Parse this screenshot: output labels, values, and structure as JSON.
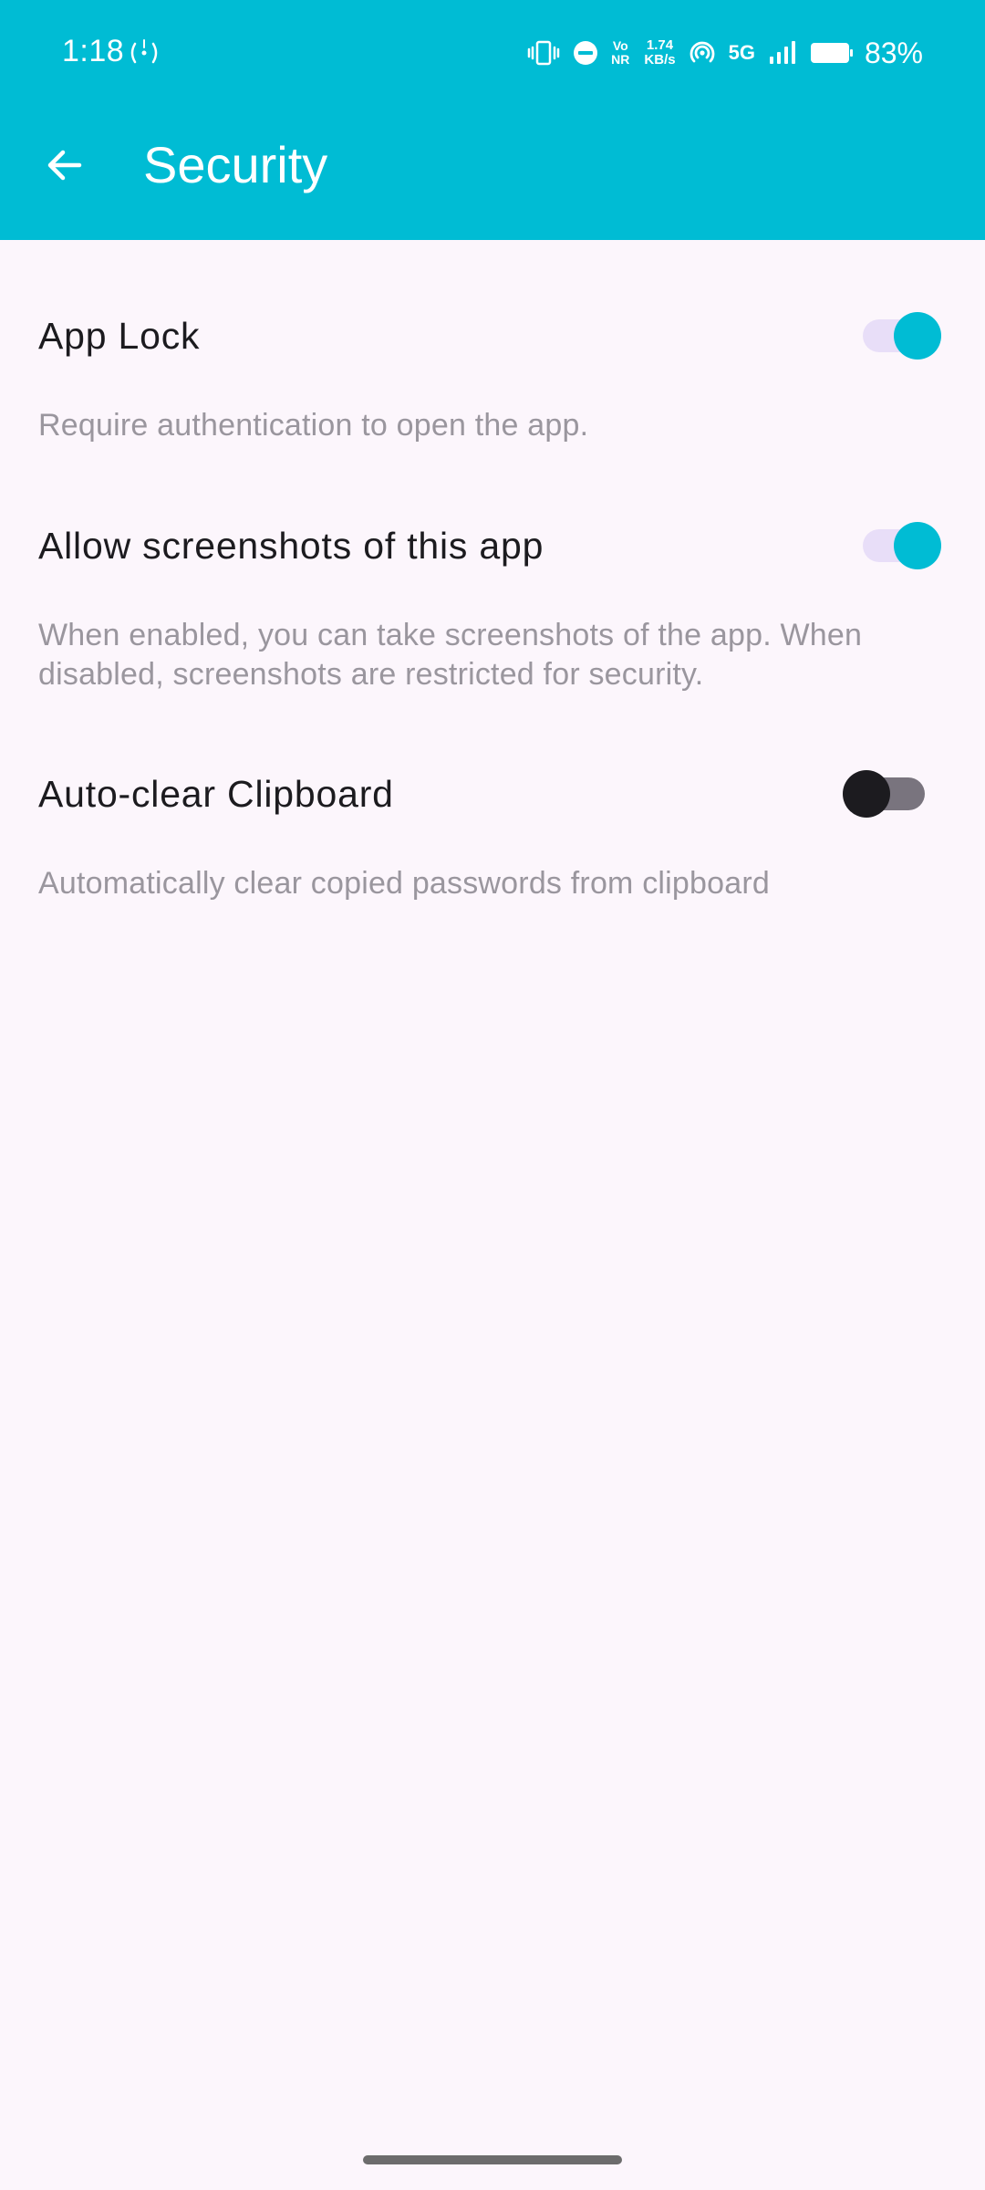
{
  "status_bar": {
    "time": "1:18",
    "network_speed_value": "1.74",
    "network_speed_unit": "KB/s",
    "volte_top": "Vo",
    "volte_bottom": "NR",
    "network_type": "5G",
    "battery_percent": "83%",
    "icons": [
      "hotspot-icon",
      "vibrate-icon",
      "do-not-disturb-icon",
      "volte-icon",
      "wifi-hotspot-icon",
      "signal-icon",
      "battery-icon"
    ]
  },
  "app_bar": {
    "title": "Security",
    "back_icon": "arrow-back-icon"
  },
  "settings": [
    {
      "title": "App Lock",
      "description": "Require authentication to open the app.",
      "enabled": true
    },
    {
      "title": "Allow screenshots of this app",
      "description": "When enabled, you can take screenshots of the app. When disabled, screenshots are restricted for security.",
      "enabled": true
    },
    {
      "title": "Auto-clear Clipboard",
      "description": "Automatically clear copied passwords from clipboard",
      "enabled": false
    }
  ],
  "colors": {
    "primary": "#00bcd4",
    "background": "#fcf6fc",
    "switch_track_on": "#e8def8",
    "switch_track_off": "#79747e",
    "switch_thumb_off": "#1c1b1f",
    "description_text": "#9a969e"
  }
}
